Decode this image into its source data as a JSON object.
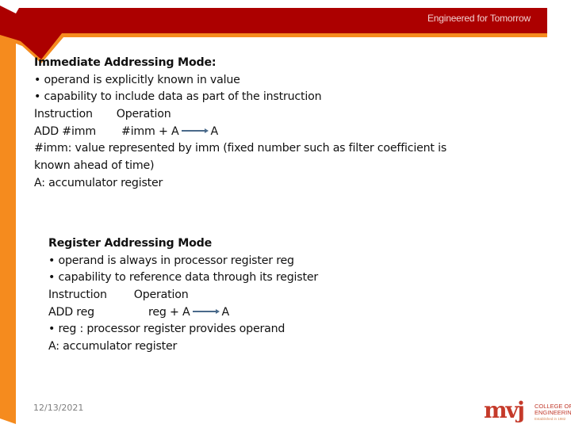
{
  "header": {
    "tagline": "Engineered for Tomorrow",
    "colors": {
      "band": "#ac0000",
      "accent": "#f58b1e"
    }
  },
  "section1": {
    "title": "Immediate Addressing Mode:",
    "bullets": [
      "• operand is explicitly known in value",
      "• capability to include data as part of the instruction"
    ],
    "table_header": {
      "instruction": "Instruction",
      "operation": "Operation"
    },
    "row": {
      "instruction": "ADD #imm",
      "operation_lhs": "#imm + A",
      "operation_result": "A"
    },
    "notes": [
      " #imm: value represented by imm (fixed number such as filter coefficient is",
      "known ahead of time)",
      "A: accumulator register"
    ]
  },
  "section2": {
    "title": "Register Addressing Mode",
    "bullets": [
      "• operand is always in processor register reg",
      "• capability to reference data through its register"
    ],
    "table_header": {
      "instruction": "Instruction",
      "operation": "Operation"
    },
    "row": {
      "instruction": "ADD reg",
      "operation_lhs": "reg + A",
      "operation_result": "A"
    },
    "notes": [
      "• reg : processor register provides operand",
      " A: accumulator register"
    ]
  },
  "footer": {
    "date": "12/13/2021",
    "logo": {
      "mark": "mvj",
      "line1": "COLLEGE OF",
      "line2": "ENGINEERING",
      "line3": "Established in 1982"
    }
  }
}
